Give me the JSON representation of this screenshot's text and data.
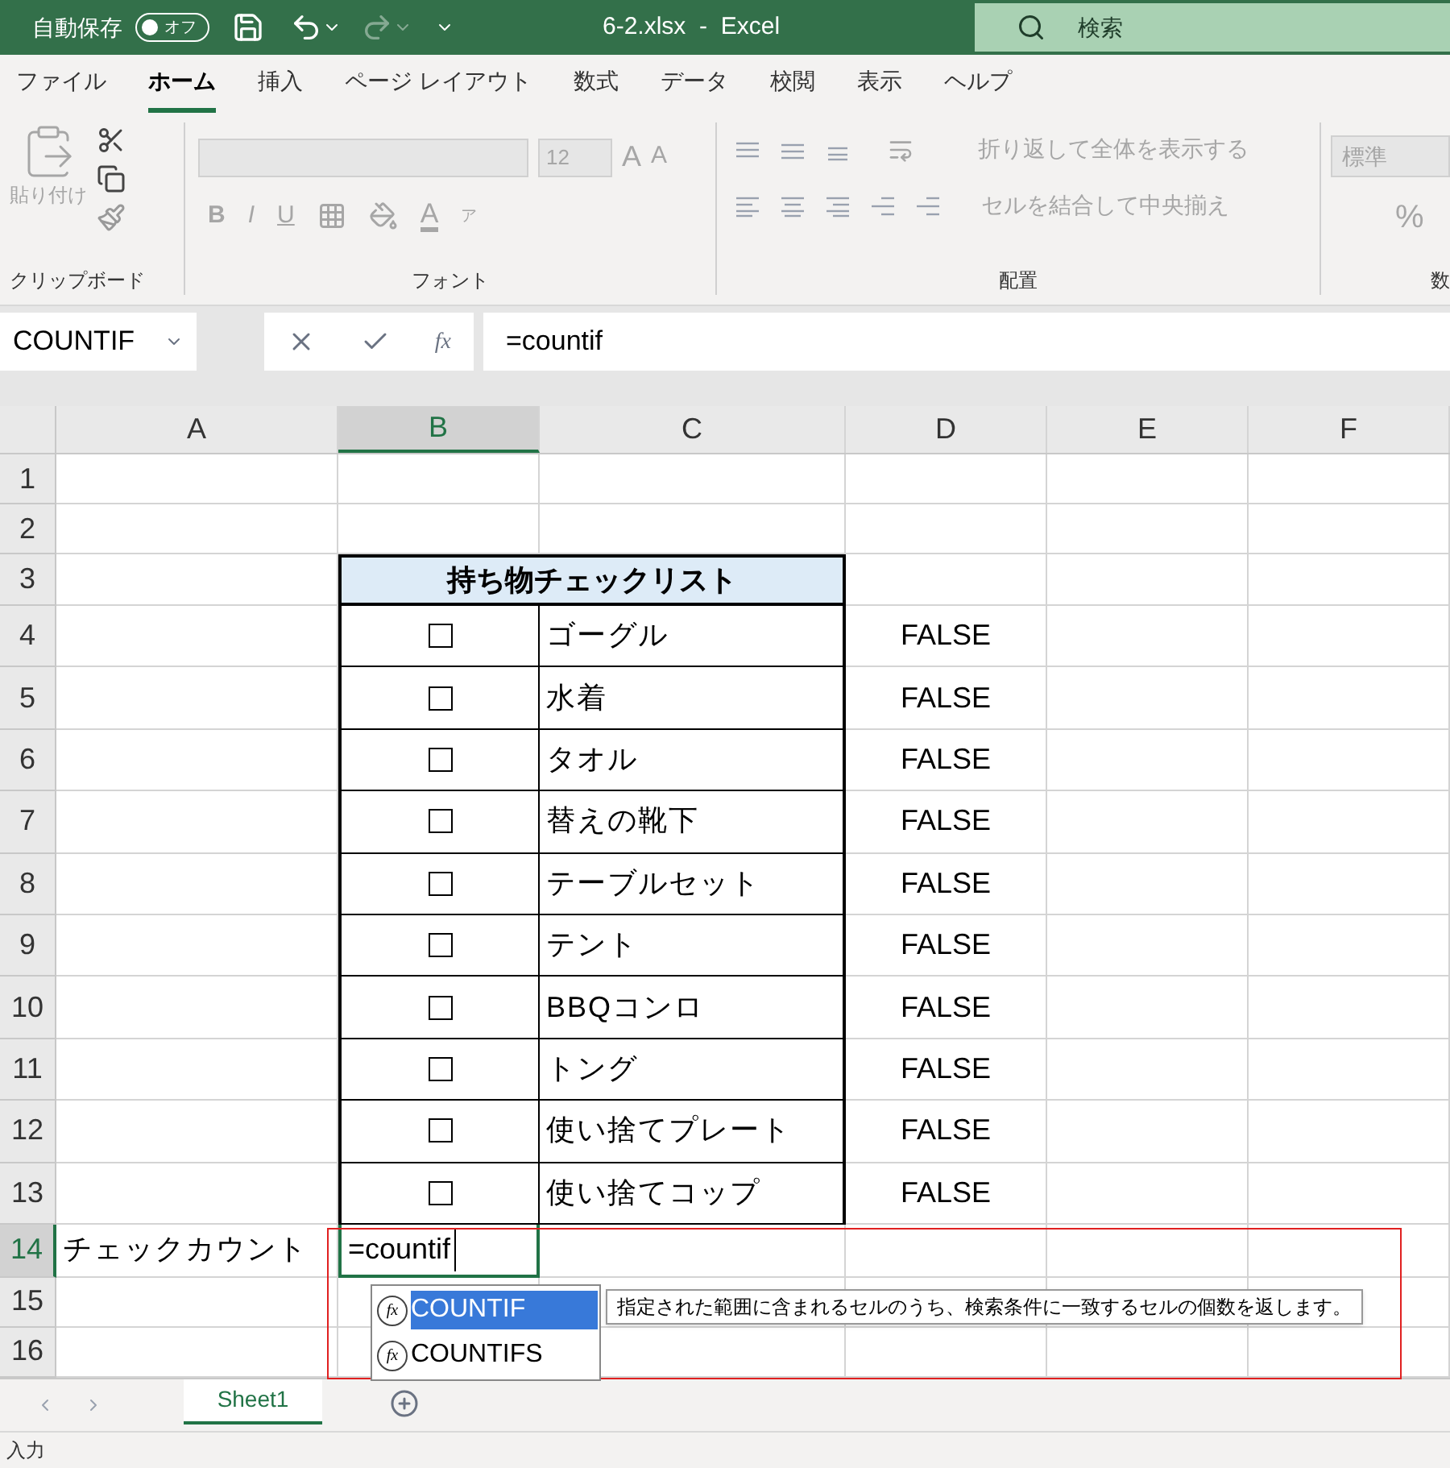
{
  "title_bar": {
    "autosave_label": "自動保存",
    "autosave_toggle": "オフ",
    "autosave_on": false,
    "file_title": "6-2.xlsx  -  Excel",
    "search_placeholder": "検索"
  },
  "menu_tabs": [
    {
      "label": "ファイル",
      "selected": false
    },
    {
      "label": "ホーム",
      "selected": true
    },
    {
      "label": "挿入",
      "selected": false
    },
    {
      "label": "ページ レイアウト",
      "selected": false
    },
    {
      "label": "数式",
      "selected": false
    },
    {
      "label": "データ",
      "selected": false
    },
    {
      "label": "校閲",
      "selected": false
    },
    {
      "label": "表示",
      "selected": false
    },
    {
      "label": "ヘルプ",
      "selected": false
    }
  ],
  "ribbon": {
    "clipboard": {
      "paste_label": "貼り付け",
      "group_label": "クリップボード"
    },
    "font": {
      "font_size": "12",
      "grow_label": "A",
      "shrink_label": "A",
      "styles": [
        "B",
        "I",
        "U"
      ],
      "font_color_label": "A",
      "phonetic_label": "ア",
      "group_label": "フォント"
    },
    "alignment": {
      "wrap_text": "折り返して全体を表示する",
      "merge_center": "セルを結合して中央揃え",
      "group_label": "配置"
    },
    "number": {
      "format": "標準",
      "percent": "%",
      "group_label": "数"
    }
  },
  "formula_bar": {
    "name_box": "COUNTIF",
    "insert_function_label": "fx",
    "formula": "=countif"
  },
  "columns": [
    {
      "label": "A",
      "selected": false
    },
    {
      "label": "B",
      "selected": true
    },
    {
      "label": "C",
      "selected": false
    },
    {
      "label": "D",
      "selected": false
    },
    {
      "label": "E",
      "selected": false
    },
    {
      "label": "F",
      "selected": false
    }
  ],
  "rows": [
    {
      "number": "1",
      "selected": false,
      "kind": "empty"
    },
    {
      "number": "2",
      "selected": false,
      "kind": "empty"
    },
    {
      "number": "3",
      "selected": false,
      "kind": "header",
      "title": "持ち物チェックリスト"
    },
    {
      "number": "4",
      "selected": false,
      "kind": "item",
      "checked": false,
      "item": "ゴーグル",
      "linked": "FALSE"
    },
    {
      "number": "5",
      "selected": false,
      "kind": "item",
      "checked": false,
      "item": "水着",
      "linked": "FALSE"
    },
    {
      "number": "6",
      "selected": false,
      "kind": "item",
      "checked": false,
      "item": "タオル",
      "linked": "FALSE"
    },
    {
      "number": "7",
      "selected": false,
      "kind": "item",
      "checked": false,
      "item": "替えの靴下",
      "linked": "FALSE"
    },
    {
      "number": "8",
      "selected": false,
      "kind": "item",
      "checked": false,
      "item": "テーブルセット",
      "linked": "FALSE"
    },
    {
      "number": "9",
      "selected": false,
      "kind": "item",
      "checked": false,
      "item": "テント",
      "linked": "FALSE"
    },
    {
      "number": "10",
      "selected": false,
      "kind": "item",
      "checked": false,
      "item": "BBQコンロ",
      "linked": "FALSE"
    },
    {
      "number": "11",
      "selected": false,
      "kind": "item",
      "checked": false,
      "item": "トング",
      "linked": "FALSE"
    },
    {
      "number": "12",
      "selected": false,
      "kind": "item",
      "checked": false,
      "item": "使い捨てプレート",
      "linked": "FALSE"
    },
    {
      "number": "13",
      "selected": false,
      "kind": "item",
      "checked": false,
      "item": "使い捨てコップ",
      "linked": "FALSE"
    },
    {
      "number": "14",
      "selected": true,
      "kind": "count",
      "label": "チェックカウント",
      "editing": "=countif"
    },
    {
      "number": "15",
      "selected": false,
      "kind": "empty"
    },
    {
      "number": "16",
      "selected": false,
      "kind": "empty"
    }
  ],
  "autocomplete": {
    "items": [
      {
        "icon_label": "fx",
        "label": "COUNTIF",
        "selected": true
      },
      {
        "icon_label": "fx",
        "label": "COUNTIFS",
        "selected": false
      }
    ],
    "tooltip": "指定された範囲に含まれるセルのうち、検索条件に一致するセルの個数を返します。"
  },
  "sheet_tabs": [
    {
      "label": "Sheet1",
      "selected": true
    }
  ],
  "status_bar": {
    "mode": "入力"
  }
}
